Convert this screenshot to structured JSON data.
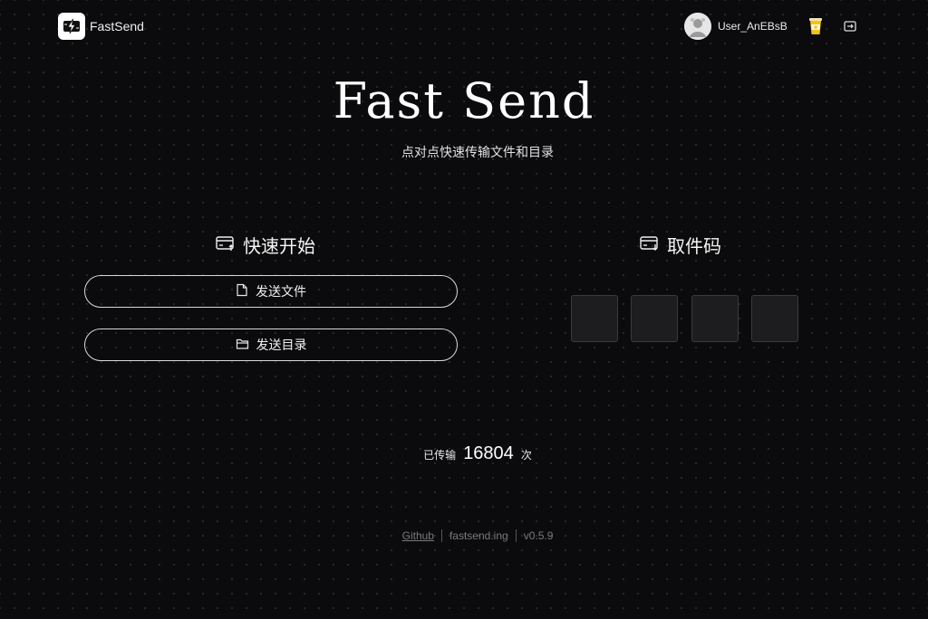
{
  "header": {
    "brand_name": "FastSend",
    "username": "User_AnEBsB"
  },
  "hero": {
    "title": "Fast Send",
    "subtitle": "点对点快速传输文件和目录"
  },
  "quick_start": {
    "title": "快速开始",
    "send_files_label": "发送文件",
    "send_dir_label": "发送目录"
  },
  "pickup": {
    "title": "取件码",
    "code_digits": [
      "",
      "",
      "",
      ""
    ]
  },
  "stats": {
    "prefix": "已传输",
    "count": "16804",
    "suffix": "次"
  },
  "footer": {
    "github": "Github",
    "site": "fastsend.ing",
    "version": "v0.5.9"
  },
  "colors": {
    "background": "#0b0a0c",
    "text": "#f2f2f2",
    "box_fill": "#1d1d20",
    "box_border": "#3a3a3d",
    "footer_text": "#7a7a7a"
  },
  "icons": {
    "brand": "lightning-logo-icon",
    "avatar": "user-avatar-icon",
    "coffee": "coffee-cup-icon",
    "logout": "logout-icon",
    "quick_start": "upload-card-icon",
    "pickup": "download-card-icon",
    "send_files": "file-icon",
    "send_dir": "folder-icon"
  }
}
